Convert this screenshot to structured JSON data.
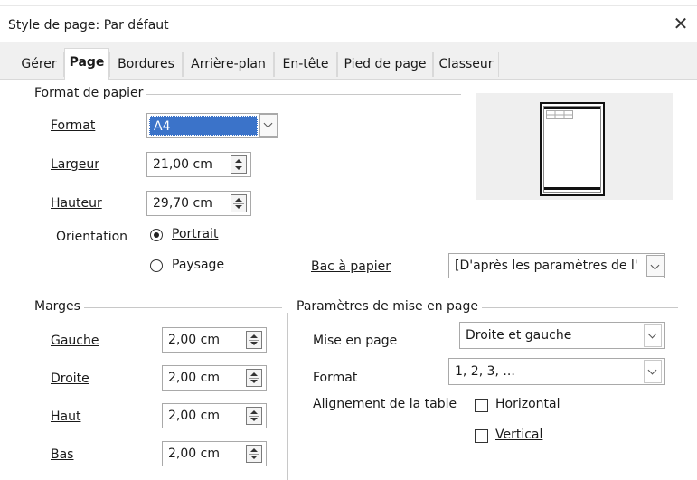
{
  "dialog": {
    "title": "Style de page: Par défaut"
  },
  "tabs": [
    {
      "label": "Gérer",
      "active": false
    },
    {
      "label": "Page",
      "active": true
    },
    {
      "label": "Bordures",
      "active": false
    },
    {
      "label": "Arrière-plan",
      "active": false
    },
    {
      "label": "En-tête",
      "active": false
    },
    {
      "label": "Pied de page",
      "active": false
    },
    {
      "label": "Classeur",
      "active": false
    }
  ],
  "paper": {
    "section_title": "Format de papier",
    "format_label": "Format",
    "format_value": "A4",
    "width_label": "Largeur",
    "width_value": "21,00 cm",
    "height_label": "Hauteur",
    "height_value": "29,70 cm",
    "orientation_label": "Orientation",
    "portrait_label": "Portrait",
    "landscape_label": "Paysage",
    "orientation_selected": "Portrait",
    "tray_label": "Bac à papier",
    "tray_value": "[D'après les paramètres de l'"
  },
  "margins": {
    "section_title": "Marges",
    "left_label": "Gauche",
    "left_value": "2,00 cm",
    "right_label": "Droite",
    "right_value": "2,00 cm",
    "top_label": "Haut",
    "top_value": "2,00 cm",
    "bottom_label": "Bas",
    "bottom_value": "2,00 cm"
  },
  "layout": {
    "section_title": "Paramètres de mise en page",
    "page_layout_label": "Mise en page",
    "page_layout_value": "Droite et gauche",
    "format_label": "Format",
    "format_value": "1, 2, 3, ...",
    "table_align_label": "Alignement de la table",
    "horizontal_label": "Horizontal",
    "horizontal_checked": false,
    "vertical_label": "Vertical",
    "vertical_checked": false
  },
  "colors": {
    "selection": "#3b73c9",
    "active_tab_bg": "#ffffff",
    "tab_bg": "#f0f0f0"
  }
}
